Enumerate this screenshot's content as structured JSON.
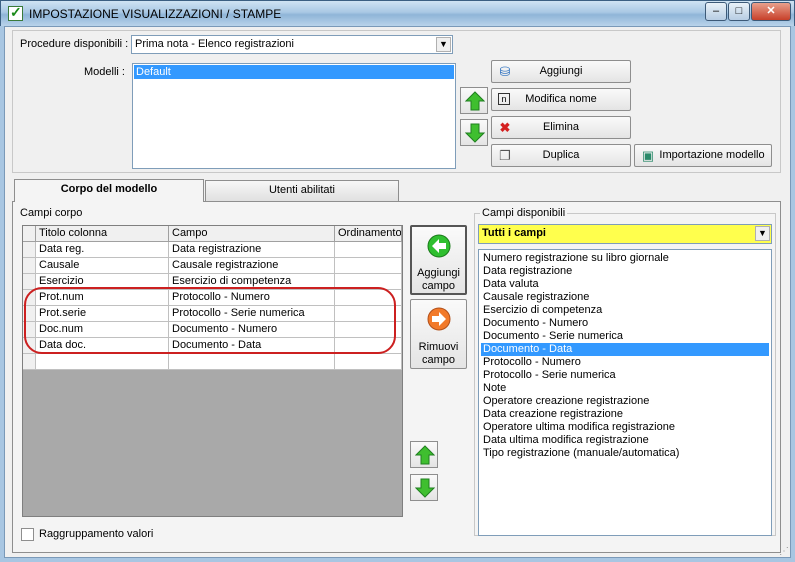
{
  "window": {
    "title": "IMPOSTAZIONE VISUALIZZAZIONI / STAMPE",
    "minimize": "–",
    "maximize": "□",
    "close": "✕"
  },
  "procedure": {
    "label": "Procedure disponibili :",
    "value": "Prima nota - Elenco registrazioni"
  },
  "modelli": {
    "label": "Modelli :",
    "items": [
      "Default"
    ]
  },
  "buttons": {
    "aggiungi": "Aggiungi",
    "modifica_nome": "Modifica nome",
    "elimina": "Elimina",
    "duplica": "Duplica",
    "importazione": "Importazione modello"
  },
  "tabs": {
    "corpo": "Corpo del modello",
    "utenti": "Utenti abilitati"
  },
  "campi_corpo": {
    "label": "Campi corpo",
    "columns": [
      "Titolo colonna",
      "Campo",
      "Ordinamento"
    ],
    "rows": [
      [
        "Data reg.",
        "Data registrazione",
        ""
      ],
      [
        "Causale",
        "Causale registrazione",
        ""
      ],
      [
        "Esercizio",
        "Esercizio di competenza",
        ""
      ],
      [
        "Prot.num",
        "Protocollo - Numero",
        ""
      ],
      [
        "Prot.serie",
        "Protocollo - Serie numerica",
        ""
      ],
      [
        "Doc.num",
        "Documento - Numero",
        ""
      ],
      [
        "Data doc.",
        "Documento - Data",
        ""
      ],
      [
        "",
        "",
        ""
      ]
    ]
  },
  "aggiungi_campo": {
    "line1": "Aggiungi",
    "line2": "campo"
  },
  "rimuovi_campo": {
    "line1": "Rimuovi",
    "line2": "campo"
  },
  "campi_disponibili": {
    "label": "Campi disponibili",
    "filter": "Tutti i campi",
    "items": [
      "Numero registrazione su libro giornale",
      "Data registrazione",
      "Data valuta",
      "Causale registrazione",
      "Esercizio di competenza",
      "Documento - Numero",
      "Documento - Serie numerica",
      "Documento - Data",
      "Protocollo - Numero",
      "Protocollo - Serie numerica",
      "Note",
      "Operatore creazione registrazione",
      "Data creazione registrazione",
      "Operatore ultima modifica registrazione",
      "Data ultima modifica registrazione",
      "Tipo registrazione (manuale/automatica)"
    ],
    "selected_index": 7
  },
  "raggruppamento": {
    "label": "Raggruppamento valori",
    "checked": false
  },
  "colors": {
    "selection": "#3399ff",
    "filter_bg": "#ffff4d",
    "highlight": "#cc2020"
  }
}
